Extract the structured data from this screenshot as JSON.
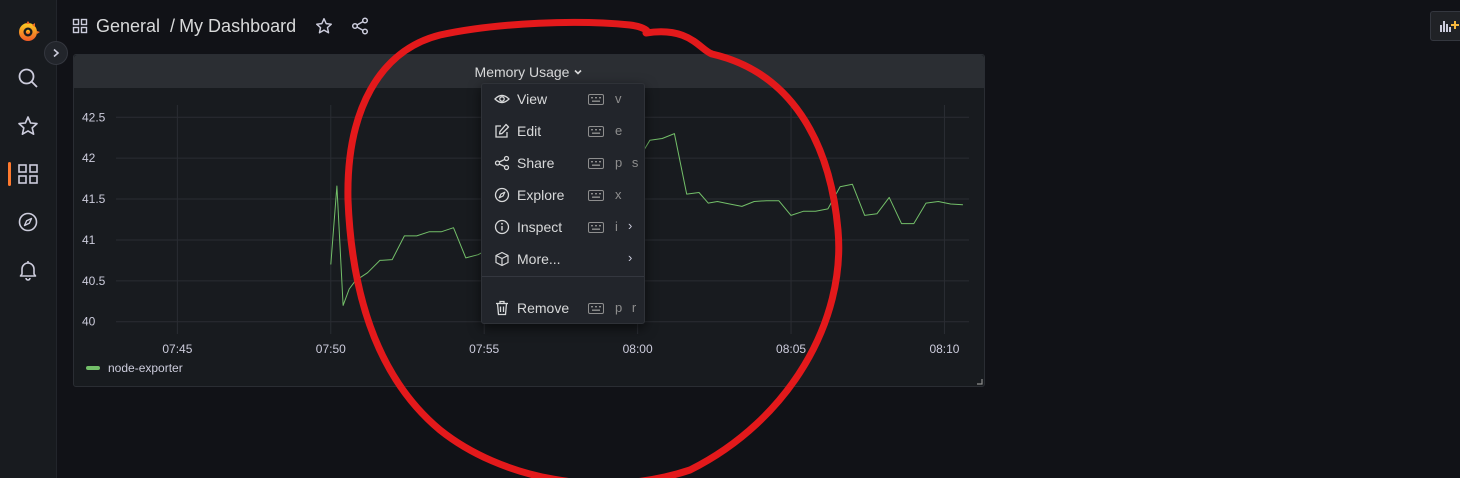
{
  "header": {
    "breadcrumb_folder": "General",
    "breadcrumb_separator": "/",
    "dashboard_title": "My Dashboard"
  },
  "sidebar": {
    "items": [
      {
        "icon": "grafana-logo-icon"
      },
      {
        "icon": "search-icon"
      },
      {
        "icon": "star-icon"
      },
      {
        "icon": "dashboards-icon",
        "active": true
      },
      {
        "icon": "explore-compass-icon"
      },
      {
        "icon": "alerting-bell-icon"
      }
    ],
    "accent": "#ff7a2e"
  },
  "panel": {
    "title": "Memory Usage",
    "legend": [
      {
        "name": "node-exporter",
        "color": "#73bf69"
      }
    ]
  },
  "context_menu": {
    "items": [
      {
        "label": "View",
        "shortcut": "v",
        "icon": "eye-icon"
      },
      {
        "label": "Edit",
        "shortcut": "e",
        "icon": "edit-icon"
      },
      {
        "label": "Share",
        "shortcut": "p s",
        "icon": "share-icon"
      },
      {
        "label": "Explore",
        "shortcut": "x",
        "icon": "compass-icon"
      },
      {
        "label": "Inspect",
        "shortcut": "i",
        "icon": "info-icon",
        "submenu": true
      },
      {
        "label": "More...",
        "shortcut": "",
        "icon": "cube-icon",
        "submenu": true
      },
      {
        "label": "Remove",
        "shortcut": "p r",
        "icon": "trash-icon"
      }
    ]
  },
  "annotation": {
    "color": "#e3191b",
    "shape": "hand-drawn circle"
  },
  "chart_data": {
    "type": "line",
    "x_ticks": [
      "07:45",
      "07:50",
      "07:55",
      "08:00",
      "08:05",
      "08:10"
    ],
    "y_ticks": [
      "40",
      "40.5",
      "41",
      "41.5",
      "42",
      "42.5"
    ],
    "ylim": [
      39.85,
      42.65
    ],
    "xlim_minutes": [
      -2.0,
      25.8
    ],
    "grid": true,
    "legend_position": "bottom-left",
    "series": [
      {
        "name": "node-exporter",
        "color": "#73bf69",
        "x_minutes": [
          5.0,
          5.2,
          5.4,
          5.6,
          5.8,
          6.2,
          6.6,
          7.0,
          7.4,
          7.8,
          8.2,
          8.6,
          9.0,
          9.4,
          9.8,
          10.2,
          10.6,
          11.0,
          11.4,
          11.8,
          12.2,
          12.6,
          13.0,
          13.4,
          13.8,
          14.2,
          14.6,
          15.0,
          15.4,
          15.8,
          16.2,
          16.6,
          17.0,
          17.3,
          17.6,
          18.0,
          18.4,
          18.8,
          19.2,
          19.6,
          20.0,
          20.4,
          20.8,
          21.2,
          21.6,
          22.0,
          22.4,
          22.8,
          23.2,
          23.6,
          24.0,
          24.4,
          24.8,
          25.2,
          25.6
        ],
        "values": [
          40.7,
          41.66,
          40.2,
          40.4,
          40.5,
          40.6,
          40.75,
          40.76,
          41.05,
          41.05,
          41.1,
          41.1,
          41.15,
          40.78,
          40.82,
          40.9,
          41.2,
          41.4,
          41.55,
          41.6,
          41.6,
          41.2,
          41.3,
          41.5,
          41.52,
          41.75,
          42.55,
          41.97,
          42.22,
          42.24,
          42.3,
          41.56,
          41.58,
          41.45,
          41.47,
          41.44,
          41.41,
          41.47,
          41.48,
          41.48,
          41.3,
          41.35,
          41.35,
          41.38,
          41.65,
          41.68,
          41.3,
          41.32,
          41.52,
          41.2,
          41.2,
          41.45,
          41.47,
          41.44,
          41.43
        ]
      }
    ]
  }
}
